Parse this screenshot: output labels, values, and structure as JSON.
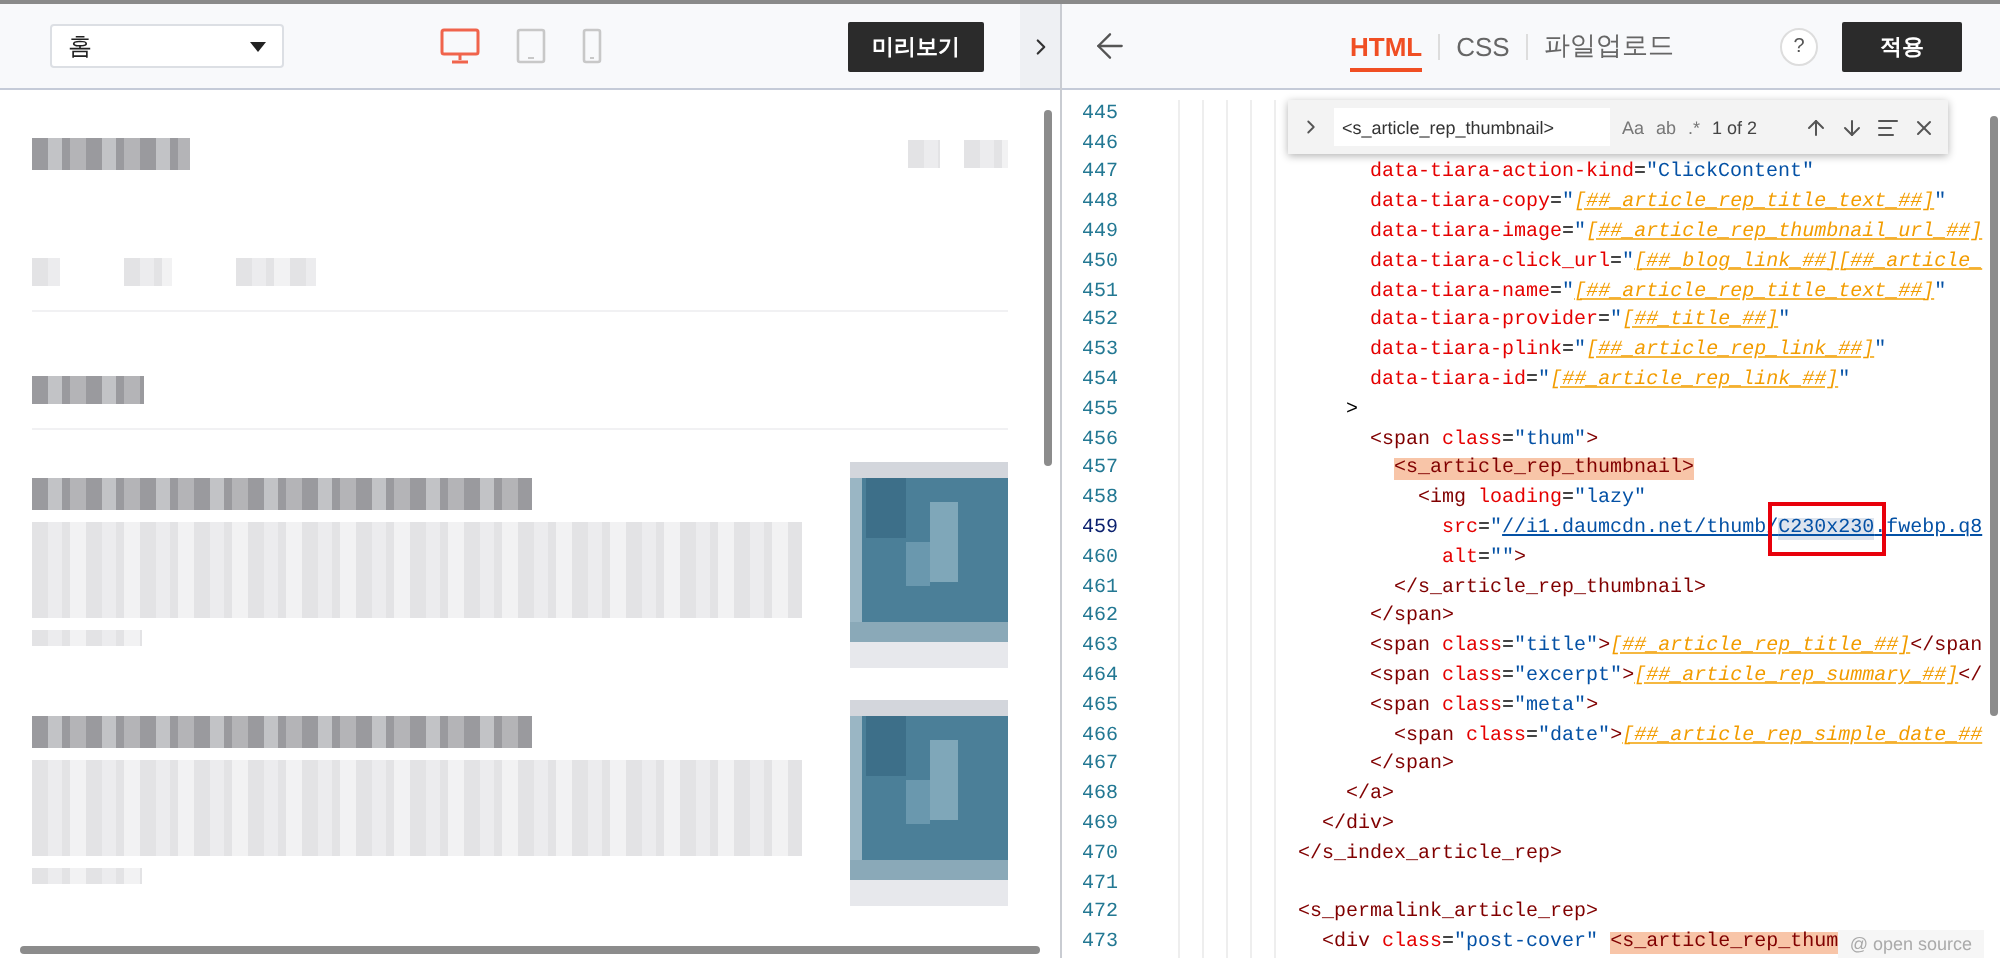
{
  "preview_toolbar": {
    "page_select": {
      "value": "홈"
    },
    "devices": [
      {
        "kind": "desktop",
        "selected": true
      },
      {
        "kind": "tablet",
        "selected": false
      },
      {
        "kind": "mobile",
        "selected": false
      }
    ],
    "preview_button": "미리보기"
  },
  "editor_toolbar": {
    "tabs": [
      {
        "label": "HTML",
        "selected": true
      },
      {
        "label": "CSS",
        "selected": false
      },
      {
        "label": "파일업로드",
        "selected": false
      }
    ],
    "help": "?",
    "apply_button": "적용"
  },
  "find_widget": {
    "query": "<s_article_rep_thumbnail>",
    "options": [
      "Aa",
      "ab",
      ".*"
    ],
    "count": "1 of 2"
  },
  "code_lines": [
    {
      "num": "445",
      "current": false
    },
    {
      "num": "446",
      "current": false
    },
    {
      "num": "447",
      "current": false,
      "tokens": [
        {
          "kind": "attr",
          "t": "      data-tiara-action-kind"
        },
        {
          "kind": "p",
          "t": "="
        },
        {
          "kind": "str",
          "t": "\"ClickContent\""
        }
      ]
    },
    {
      "num": "448",
      "current": false,
      "tokens": [
        {
          "kind": "attr",
          "t": "      data-tiara-copy"
        },
        {
          "kind": "p",
          "t": "="
        },
        {
          "kind": "str",
          "t": "\""
        },
        {
          "kind": "tpl",
          "t": "[##_article_rep_title_text_##]"
        },
        {
          "kind": "str",
          "t": "\""
        }
      ]
    },
    {
      "num": "449",
      "current": false,
      "tokens": [
        {
          "kind": "attr",
          "t": "      data-tiara-image"
        },
        {
          "kind": "p",
          "t": "="
        },
        {
          "kind": "str",
          "t": "\""
        },
        {
          "kind": "tpl",
          "t": "[##_article_rep_thumbnail_url_##]"
        }
      ]
    },
    {
      "num": "450",
      "current": false,
      "tokens": [
        {
          "kind": "attr",
          "t": "      data-tiara-click_url"
        },
        {
          "kind": "p",
          "t": "="
        },
        {
          "kind": "str",
          "t": "\""
        },
        {
          "kind": "tpl",
          "t": "[##_blog_link_##][##_article_"
        }
      ]
    },
    {
      "num": "451",
      "current": false,
      "tokens": [
        {
          "kind": "attr",
          "t": "      data-tiara-name"
        },
        {
          "kind": "p",
          "t": "="
        },
        {
          "kind": "str",
          "t": "\""
        },
        {
          "kind": "tpl",
          "t": "[##_article_rep_title_text_##]"
        },
        {
          "kind": "str",
          "t": "\""
        }
      ]
    },
    {
      "num": "452",
      "current": false,
      "tokens": [
        {
          "kind": "attr",
          "t": "      data-tiara-provider"
        },
        {
          "kind": "p",
          "t": "="
        },
        {
          "kind": "str",
          "t": "\""
        },
        {
          "kind": "tpl",
          "t": "[##_title_##]"
        },
        {
          "kind": "str",
          "t": "\""
        }
      ]
    },
    {
      "num": "453",
      "current": false,
      "tokens": [
        {
          "kind": "attr",
          "t": "      data-tiara-plink"
        },
        {
          "kind": "p",
          "t": "="
        },
        {
          "kind": "str",
          "t": "\""
        },
        {
          "kind": "tpl",
          "t": "[##_article_rep_link_##]"
        },
        {
          "kind": "str",
          "t": "\""
        }
      ]
    },
    {
      "num": "454",
      "current": false,
      "tokens": [
        {
          "kind": "attr",
          "t": "      data-tiara-id"
        },
        {
          "kind": "p",
          "t": "="
        },
        {
          "kind": "str",
          "t": "\""
        },
        {
          "kind": "tpl",
          "t": "[##_article_rep_link_##]"
        },
        {
          "kind": "str",
          "t": "\""
        }
      ]
    },
    {
      "num": "455",
      "current": false,
      "tokens": [
        {
          "kind": "p",
          "t": "    >"
        }
      ]
    },
    {
      "num": "456",
      "current": false,
      "tokens": [
        {
          "kind": "tag",
          "t": "      <span"
        },
        {
          "kind": "attr",
          "t": " class"
        },
        {
          "kind": "p",
          "t": "="
        },
        {
          "kind": "str",
          "t": "\"thum\""
        },
        {
          "kind": "tag",
          "t": ">"
        }
      ]
    },
    {
      "num": "457",
      "current": false,
      "tokens": [
        {
          "kind": "match",
          "t": "        <s_article_rep_thumbnail>"
        }
      ]
    },
    {
      "num": "458",
      "current": false,
      "tokens": [
        {
          "kind": "tag",
          "t": "          <img"
        },
        {
          "kind": "attr",
          "t": " loading"
        },
        {
          "kind": "p",
          "t": "="
        },
        {
          "kind": "str",
          "t": "\"lazy\""
        }
      ]
    },
    {
      "num": "459",
      "current": true,
      "tokens": [
        {
          "kind": "attr",
          "t": "            src"
        },
        {
          "kind": "p",
          "t": "="
        },
        {
          "kind": "str",
          "t": "\""
        },
        {
          "kind": "link",
          "t": "//i1.daumcdn.net/thumb/"
        },
        {
          "kind": "current_match",
          "t": "C230x230",
          "boxed": true
        },
        {
          "kind": "link",
          "t": ".fwebp.q8"
        }
      ]
    },
    {
      "num": "460",
      "current": false,
      "tokens": [
        {
          "kind": "attr",
          "t": "            alt"
        },
        {
          "kind": "p",
          "t": "="
        },
        {
          "kind": "str",
          "t": "\"\""
        },
        {
          "kind": "tag",
          "t": ">"
        }
      ]
    },
    {
      "num": "461",
      "current": false,
      "tokens": [
        {
          "kind": "tag",
          "t": "        </s_article_rep_thumbnail>"
        }
      ]
    },
    {
      "num": "462",
      "current": false,
      "tokens": [
        {
          "kind": "tag",
          "t": "      </span>"
        }
      ]
    },
    {
      "num": "463",
      "current": false,
      "tokens": [
        {
          "kind": "tag",
          "t": "      <span"
        },
        {
          "kind": "attr",
          "t": " class"
        },
        {
          "kind": "p",
          "t": "="
        },
        {
          "kind": "str",
          "t": "\"title\""
        },
        {
          "kind": "tag",
          "t": ">"
        },
        {
          "kind": "tpl",
          "t": "[##_article_rep_title_##]"
        },
        {
          "kind": "tag",
          "t": "</span"
        }
      ]
    },
    {
      "num": "464",
      "current": false,
      "tokens": [
        {
          "kind": "tag",
          "t": "      <span"
        },
        {
          "kind": "attr",
          "t": " class"
        },
        {
          "kind": "p",
          "t": "="
        },
        {
          "kind": "str",
          "t": "\"excerpt\""
        },
        {
          "kind": "tag",
          "t": ">"
        },
        {
          "kind": "tpl",
          "t": "[##_article_rep_summary_##]"
        },
        {
          "kind": "tag",
          "t": "</"
        }
      ]
    },
    {
      "num": "465",
      "current": false,
      "tokens": [
        {
          "kind": "tag",
          "t": "      <span"
        },
        {
          "kind": "attr",
          "t": " class"
        },
        {
          "kind": "p",
          "t": "="
        },
        {
          "kind": "str",
          "t": "\"meta\""
        },
        {
          "kind": "tag",
          "t": ">"
        }
      ]
    },
    {
      "num": "466",
      "current": false,
      "tokens": [
        {
          "kind": "tag",
          "t": "        <span"
        },
        {
          "kind": "attr",
          "t": " class"
        },
        {
          "kind": "p",
          "t": "="
        },
        {
          "kind": "str",
          "t": "\"date\""
        },
        {
          "kind": "tag",
          "t": ">"
        },
        {
          "kind": "tpl",
          "t": "[##_article_rep_simple_date_##"
        }
      ]
    },
    {
      "num": "467",
      "current": false,
      "tokens": [
        {
          "kind": "tag",
          "t": "      </span>"
        }
      ]
    },
    {
      "num": "468",
      "current": false,
      "tokens": [
        {
          "kind": "tag",
          "t": "    </a>"
        }
      ]
    },
    {
      "num": "469",
      "current": false,
      "tokens": [
        {
          "kind": "tag",
          "t": "  </div>"
        }
      ]
    },
    {
      "num": "470",
      "current": false,
      "tokens": [
        {
          "kind": "tag",
          "t": "</s_index_article_rep>"
        }
      ]
    },
    {
      "num": "471",
      "current": false
    },
    {
      "num": "472",
      "current": false,
      "tokens": [
        {
          "kind": "tag",
          "t": "<s_permalink_article_rep>"
        }
      ]
    },
    {
      "num": "473",
      "current": false,
      "tokens": [
        {
          "kind": "tag",
          "t": "  <div"
        },
        {
          "kind": "attr",
          "t": " class"
        },
        {
          "kind": "p",
          "t": "="
        },
        {
          "kind": "str",
          "t": "\"post-cover\" "
        },
        {
          "kind": "match",
          "t": "<s_article_rep_thum"
        }
      ]
    }
  ],
  "source_badge": "@ open source"
}
